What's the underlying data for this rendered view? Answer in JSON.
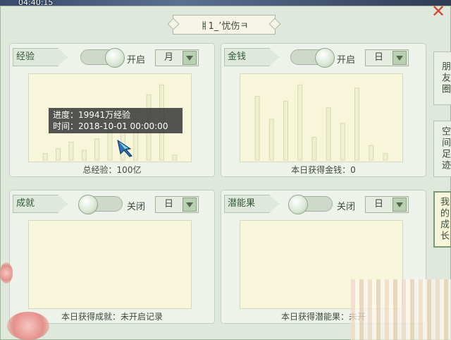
{
  "clock": "04:40:15",
  "title": "ㅒ1_’忧伤ㅋ",
  "panels": {
    "exp": {
      "tag": "经验",
      "toggle_label": "开启",
      "period": "月",
      "caption": "总经验：100亿",
      "tooltip_line1": "进度：19941万经验",
      "tooltip_line2": "时间：2018-10-01 00:00:00"
    },
    "money": {
      "tag": "金钱",
      "toggle_label": "开启",
      "period": "日",
      "caption": "本日获得金钱：0"
    },
    "achievement": {
      "tag": "成就",
      "toggle_label": "关闭",
      "period": "日",
      "caption": "本日获得成就：未开启记录"
    },
    "potential": {
      "tag": "潜能果",
      "toggle_label": "关闭",
      "period": "日",
      "caption": "本日获得潜能果：未开"
    }
  },
  "side_tabs": [
    "朋友圈",
    "空间足迹",
    "我的成长"
  ],
  "colors": {
    "bar": "#eef0cf",
    "bar_stroke": "#d7dab0",
    "accent": "#7a9a72"
  },
  "chart_data": [
    {
      "type": "bar",
      "values": [
        0.08,
        0.14,
        0.22,
        0.12,
        0.26,
        0.36,
        0.5,
        0.62,
        0.8,
        0.92,
        0.06
      ],
      "ylim": [
        0,
        1
      ]
    },
    {
      "type": "bar",
      "values": [
        0.78,
        0.5,
        0.72,
        0.92,
        0.28,
        0.64,
        0.45,
        0.88,
        0.18,
        0.08
      ],
      "ylim": [
        0,
        1
      ]
    }
  ]
}
